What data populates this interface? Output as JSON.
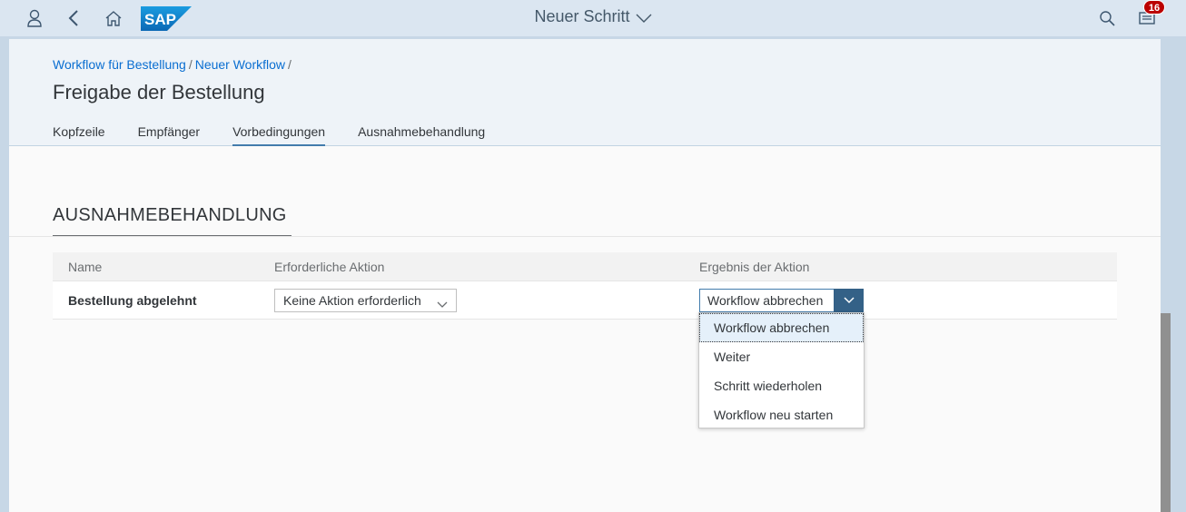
{
  "shell": {
    "title": "Neuer Schritt",
    "logo_text": "SAP",
    "notification_count": "16",
    "icons": [
      "user-icon",
      "back-icon",
      "home-icon",
      "search-icon",
      "notifications-icon"
    ]
  },
  "header": {
    "breadcrumbs": [
      "Workflow für Bestellung",
      "Neuer Workflow"
    ],
    "breadcrumb_separator": "/",
    "title": "Freigabe der Bestellung",
    "tabs": [
      "Kopfzeile",
      "Empfänger",
      "Vorbedingungen",
      "Ausnahmebehandlung"
    ],
    "active_tab": "Vorbedingungen"
  },
  "section": {
    "title": "AUSNAHMEBEHANDLUNG",
    "columns": [
      "Name",
      "Erforderliche Aktion",
      "Ergebnis der Aktion"
    ],
    "rows": [
      {
        "name": "Bestellung abgelehnt",
        "action": "Keine Aktion erforderlich",
        "result": "Workflow abbrechen"
      }
    ]
  },
  "dropdown": {
    "options": [
      "Workflow abbrechen",
      "Weiter",
      "Schritt wiederholen",
      "Workflow neu starten"
    ],
    "selected": "Workflow abbrechen"
  },
  "colors": {
    "accent": "#0a6ed1",
    "shell_bg": "#dbe6f1",
    "badge": "#bb0000",
    "select_button": "#346187"
  }
}
